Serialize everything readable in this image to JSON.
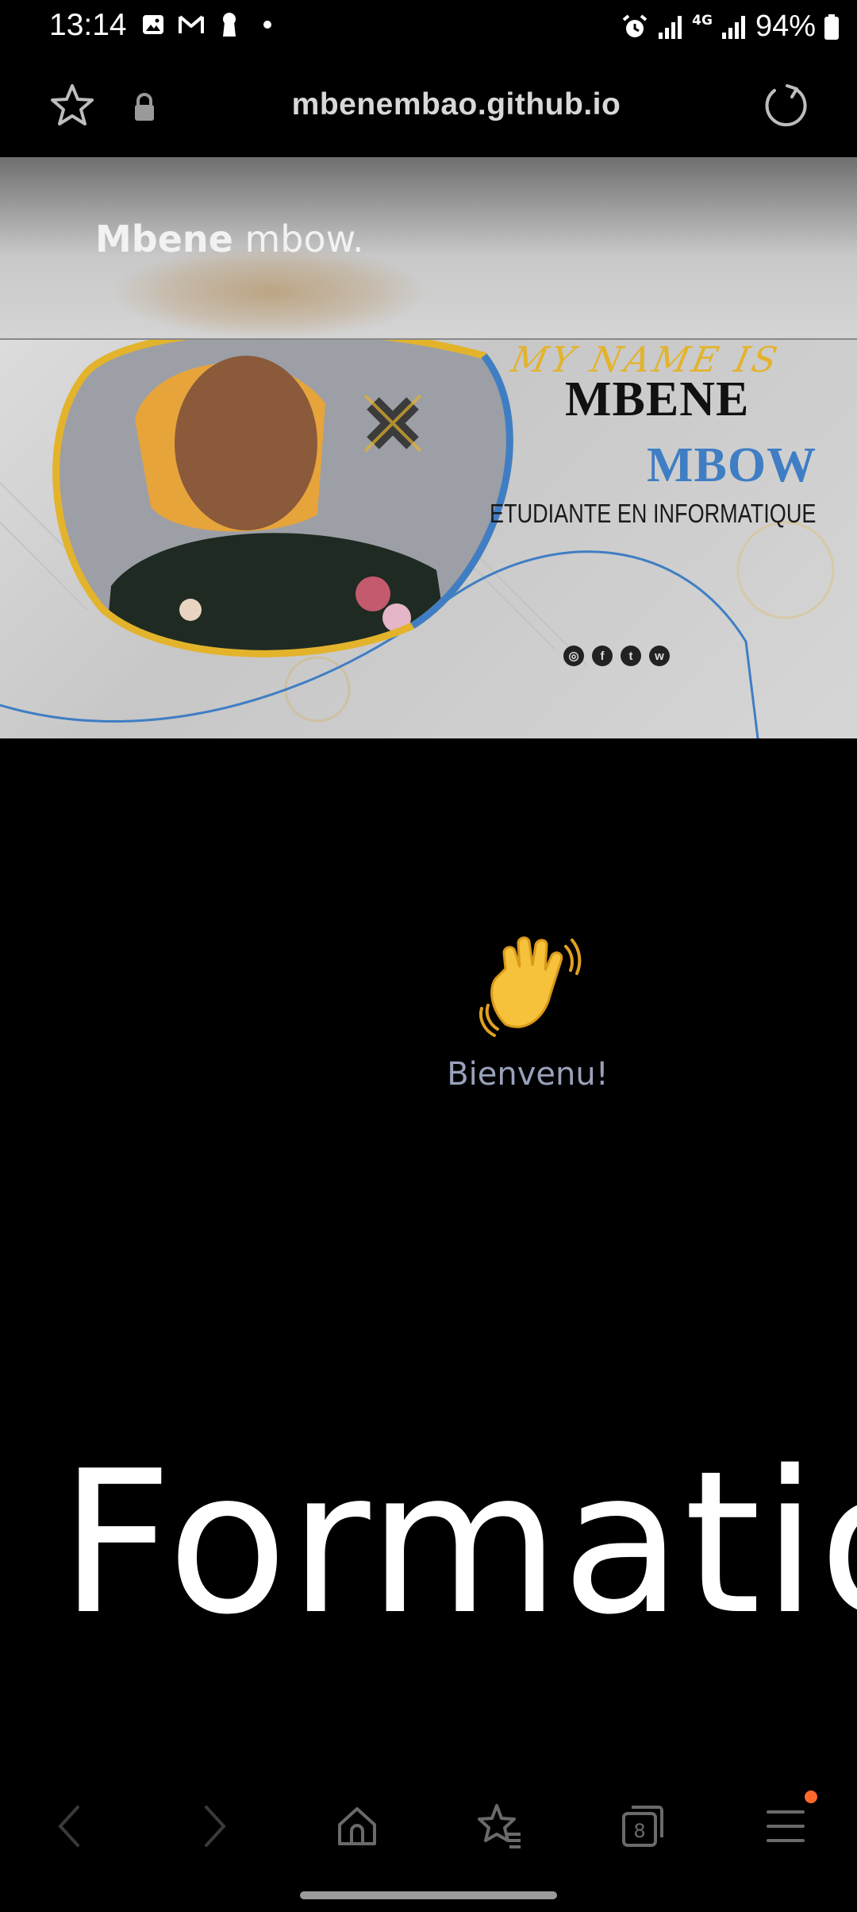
{
  "status_bar": {
    "time": "13:14",
    "battery": "94%",
    "left_icons": [
      "image-icon",
      "gmail-icon",
      "keyhole-icon",
      "dot-icon"
    ],
    "right_icons": [
      "alarm-icon",
      "signal-icon",
      "4g-signal-icon",
      "battery-icon"
    ],
    "network_label": "4G"
  },
  "browser": {
    "url": "mbenembao.github.io",
    "tabs_count": "8"
  },
  "site": {
    "brand_bold": "Mbene",
    "brand_light": " mbow."
  },
  "banner": {
    "my_name_is": "MY NAME IS",
    "first_name": "MBENE",
    "last_name": "MBOW",
    "subtitle": "ETUDIANTE EN INFORMATIQUE",
    "social": [
      "instagram-icon",
      "facebook-icon",
      "twitter-icon",
      "whatsapp-icon"
    ],
    "social_letters": [
      "◎",
      "f",
      "t",
      "w"
    ]
  },
  "welcome": {
    "text": "Bienvenu!"
  },
  "section": {
    "heading": "Formatio"
  },
  "colors": {
    "accent_blue": "#3f7ec4",
    "accent_yellow": "#e3b32c",
    "welcome_text": "#9aa1ba",
    "notification_dot": "#ff6a2b"
  }
}
